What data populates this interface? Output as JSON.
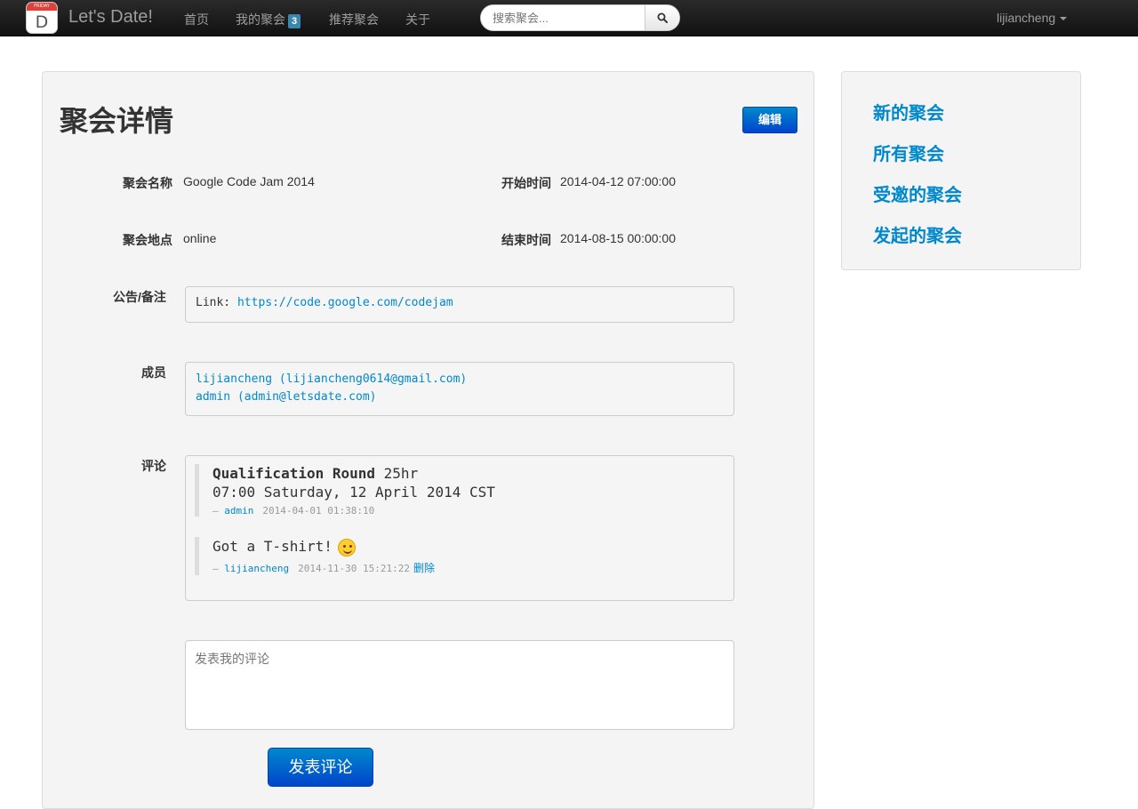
{
  "navbar": {
    "logo_day_label": "FRIDAY",
    "logo_day_letter": "D",
    "brand": "Let's Date!",
    "links": [
      {
        "label": "首页"
      },
      {
        "label": "我的聚会",
        "badge": "3"
      },
      {
        "label": "推荐聚会"
      },
      {
        "label": "关于"
      }
    ],
    "search_placeholder": "搜索聚会...",
    "user": "lijiancheng"
  },
  "main": {
    "title": "聚会详情",
    "edit_label": "编辑",
    "fields": {
      "name_label": "聚会名称",
      "name_value": "Google Code Jam 2014",
      "start_label": "开始时间",
      "start_value": "2014-04-12 07:00:00",
      "location_label": "聚会地点",
      "location_value": "online",
      "end_label": "结束时间",
      "end_value": "2014-08-15 00:00:00",
      "notice_label": "公告/备注",
      "notice_prefix": "Link: ",
      "notice_link": "https://code.google.com/codejam",
      "members_label": "成员",
      "members": [
        "lijiancheng (lijiancheng0614@gmail.com)",
        "admin (admin@letsdate.com)"
      ],
      "comments_label": "评论"
    },
    "comments": [
      {
        "title_bold": "Qualification Round",
        "title_rest": " 25hr",
        "line2": "07:00 Saturday, 12 April 2014 CST",
        "dash": "— ",
        "author": "admin",
        "date": "2014-04-01 01:38:10"
      },
      {
        "text": "Got a T-shirt!",
        "dash": "— ",
        "author": "lijiancheng",
        "date": "2014-11-30 15:21:22",
        "delete_label": "删除"
      }
    ],
    "comment_placeholder": "发表我的评论",
    "post_label": "发表评论"
  },
  "sidebar": {
    "links": [
      "新的聚会",
      "所有聚会",
      "受邀的聚会",
      "发起的聚会"
    ]
  },
  "colors": {
    "link": "#0088cc",
    "primary_button": "#0055cc",
    "navbar_bg": "#1b1b1b",
    "badge": "#3a87ad"
  }
}
